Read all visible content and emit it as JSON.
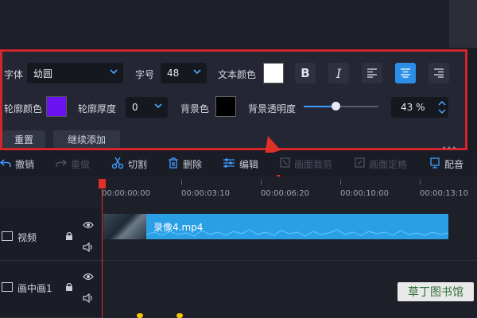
{
  "subtitle_panel": {
    "font_label": "字体",
    "font_value": "幼圆",
    "size_label": "字号",
    "size_value": "48",
    "text_color_label": "文本颜色",
    "outline_color_label": "轮廓颜色",
    "outline_width_label": "轮廓厚度",
    "outline_width_value": "0",
    "bg_color_label": "背景色",
    "bg_opacity_label": "背景透明度",
    "bg_opacity_value": "43 %",
    "bg_opacity_fraction": 0.43,
    "reset_label": "重置",
    "continue_add_label": "继续添加",
    "bold_label": "B",
    "italic_label": "I",
    "colors": {
      "text": "#ffffff",
      "outline": "#6a13f0",
      "background": "#000000",
      "accent": "#2b8ee8",
      "highlight_border": "#d2262c"
    }
  },
  "toolbar": {
    "undo": "撤销",
    "redo": "重做",
    "cut": "切割",
    "delete": "删除",
    "edit": "编辑",
    "crop": "画面裁剪",
    "freeze": "画面定格",
    "dub": "配音"
  },
  "timeline": {
    "ticks": [
      "00:00:00:00",
      "00:00:03:10",
      "00:00:06:20",
      "00:00:10:00",
      "00:00:13:10"
    ],
    "tracks": [
      {
        "name": "视频"
      },
      {
        "name": "画中画1"
      }
    ],
    "clip_name": "录像4.mp4"
  },
  "watermark": "草丁图书馆"
}
